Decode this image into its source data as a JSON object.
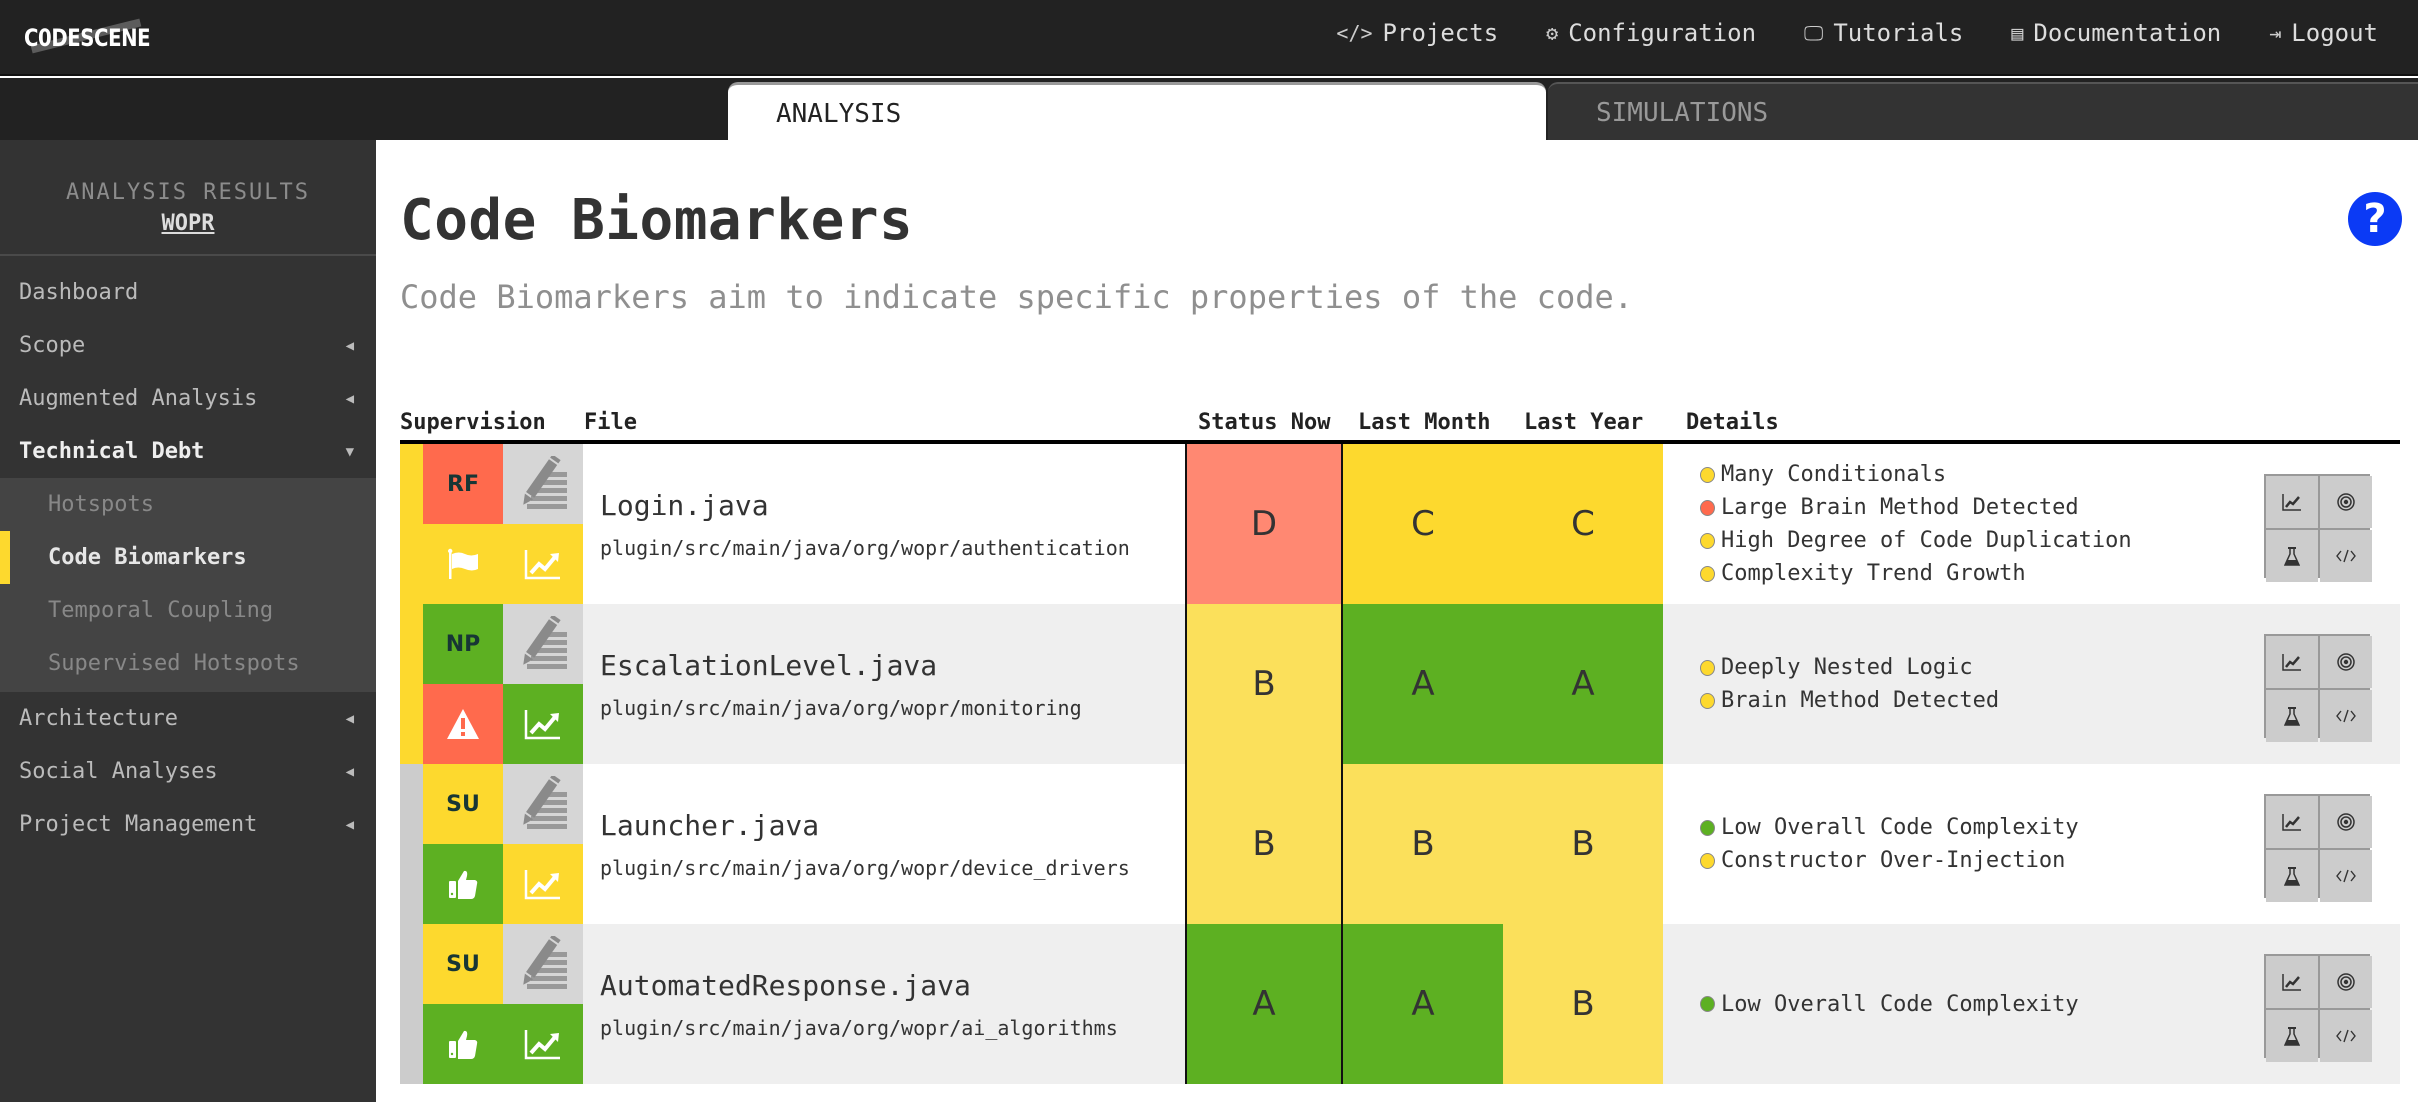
{
  "app": {
    "logo": "C0DESCENE"
  },
  "topnav": [
    {
      "icon": "code-icon",
      "glyph": "</>",
      "label": "Projects"
    },
    {
      "icon": "gears-icon",
      "glyph": "⚙",
      "label": "Configuration"
    },
    {
      "icon": "monitor-icon",
      "glyph": "🖵",
      "label": "Tutorials"
    },
    {
      "icon": "book-icon",
      "glyph": "▤",
      "label": "Documentation"
    },
    {
      "icon": "logout-icon",
      "glyph": "⇥",
      "label": "Logout"
    }
  ],
  "tabs": {
    "analysis": "ANALYSIS",
    "simulations": "SIMULATIONS",
    "active": "ANALYSIS"
  },
  "sidebar": {
    "header_label": "ANALYSIS RESULTS",
    "project": "WOPR",
    "items": [
      {
        "label": "Dashboard",
        "caret": ""
      },
      {
        "label": "Scope",
        "caret": "◀"
      },
      {
        "label": "Augmented Analysis",
        "caret": "◀"
      },
      {
        "label": "Technical Debt",
        "caret": "▼"
      },
      {
        "label": "Architecture",
        "caret": "◀"
      },
      {
        "label": "Social Analyses",
        "caret": "◀"
      },
      {
        "label": "Project Management",
        "caret": "◀"
      }
    ],
    "submenu": [
      {
        "label": "Hotspots"
      },
      {
        "label": "Code Biomarkers",
        "active": true
      },
      {
        "label": "Temporal Coupling"
      },
      {
        "label": "Supervised Hotspots"
      }
    ]
  },
  "page": {
    "title": "Code Biomarkers",
    "subtitle": "Code Biomarkers aim to indicate specific properties of the code.",
    "help": "?"
  },
  "colors": {
    "red": "#ff6a4d",
    "red_light": "#ff8872",
    "yellow": "#fdd92e",
    "yellow_light": "#fbe05b",
    "green": "#5db022",
    "grey": "#cccccc",
    "dot_yellow": "#fdd92e",
    "dot_red": "#ff6a4d",
    "dot_green": "#5db022"
  },
  "table": {
    "headers": [
      "Supervision",
      "File",
      "Status Now",
      "Last Month",
      "Last Year",
      "Details"
    ],
    "rows": [
      {
        "strip": "yellow",
        "code": "RF",
        "code_color": "red",
        "flag_icon": "flag-icon",
        "flag_glyph": "⚑",
        "flag_color": "yellow",
        "trend_color": "yellow",
        "file": "Login.java",
        "path": "plugin/src/main/java/org/wopr/authentication",
        "status_now": "D",
        "now_color": "red_light",
        "last_month": "C",
        "month_color": "yellow",
        "last_year": "C",
        "year_color": "yellow",
        "details": [
          {
            "text": "Many Conditionals",
            "severity": "yellow"
          },
          {
            "text": "Large Brain Method Detected",
            "severity": "red"
          },
          {
            "text": "High Degree of Code Duplication",
            "severity": "yellow"
          },
          {
            "text": "Complexity Trend Growth",
            "severity": "yellow"
          }
        ]
      },
      {
        "strip": "yellow",
        "code": "NP",
        "code_color": "green",
        "flag_icon": "warning-icon",
        "flag_glyph": "⚠",
        "flag_color": "red",
        "trend_color": "green",
        "file": "EscalationLevel.java",
        "path": "plugin/src/main/java/org/wopr/monitoring",
        "status_now": "B",
        "now_color": "yellow_light",
        "last_month": "A",
        "month_color": "green",
        "last_year": "A",
        "year_color": "green",
        "details": [
          {
            "text": "Deeply Nested Logic",
            "severity": "yellow"
          },
          {
            "text": "Brain Method Detected",
            "severity": "yellow"
          }
        ]
      },
      {
        "strip": "grey",
        "code": "SU",
        "code_color": "yellow",
        "flag_icon": "thumbs-up-icon",
        "flag_glyph": "👍",
        "flag_color": "green",
        "trend_color": "yellow",
        "file": "Launcher.java",
        "path": "plugin/src/main/java/org/wopr/device_drivers",
        "status_now": "B",
        "now_color": "yellow_light",
        "last_month": "B",
        "month_color": "yellow_light",
        "last_year": "B",
        "year_color": "yellow_light",
        "details": [
          {
            "text": "Low Overall Code Complexity",
            "severity": "green"
          },
          {
            "text": "Constructor Over-Injection",
            "severity": "yellow"
          }
        ]
      },
      {
        "strip": "grey",
        "code": "SU",
        "code_color": "yellow",
        "flag_icon": "thumbs-up-icon",
        "flag_glyph": "👍",
        "flag_color": "green",
        "trend_color": "green",
        "file": "AutomatedResponse.java",
        "path": "plugin/src/main/java/org/wopr/ai_algorithms",
        "status_now": "A",
        "now_color": "green",
        "last_month": "A",
        "month_color": "green",
        "last_year": "B",
        "year_color": "yellow_light",
        "details": [
          {
            "text": "Low Overall Code Complexity",
            "severity": "green"
          }
        ]
      }
    ],
    "row_actions": [
      {
        "icon": "trend-chart-icon",
        "glyph": "📈"
      },
      {
        "icon": "target-icon",
        "glyph": "◎"
      },
      {
        "icon": "flask-icon",
        "glyph": "⚗"
      },
      {
        "icon": "code-icon",
        "glyph": "</>"
      }
    ]
  }
}
